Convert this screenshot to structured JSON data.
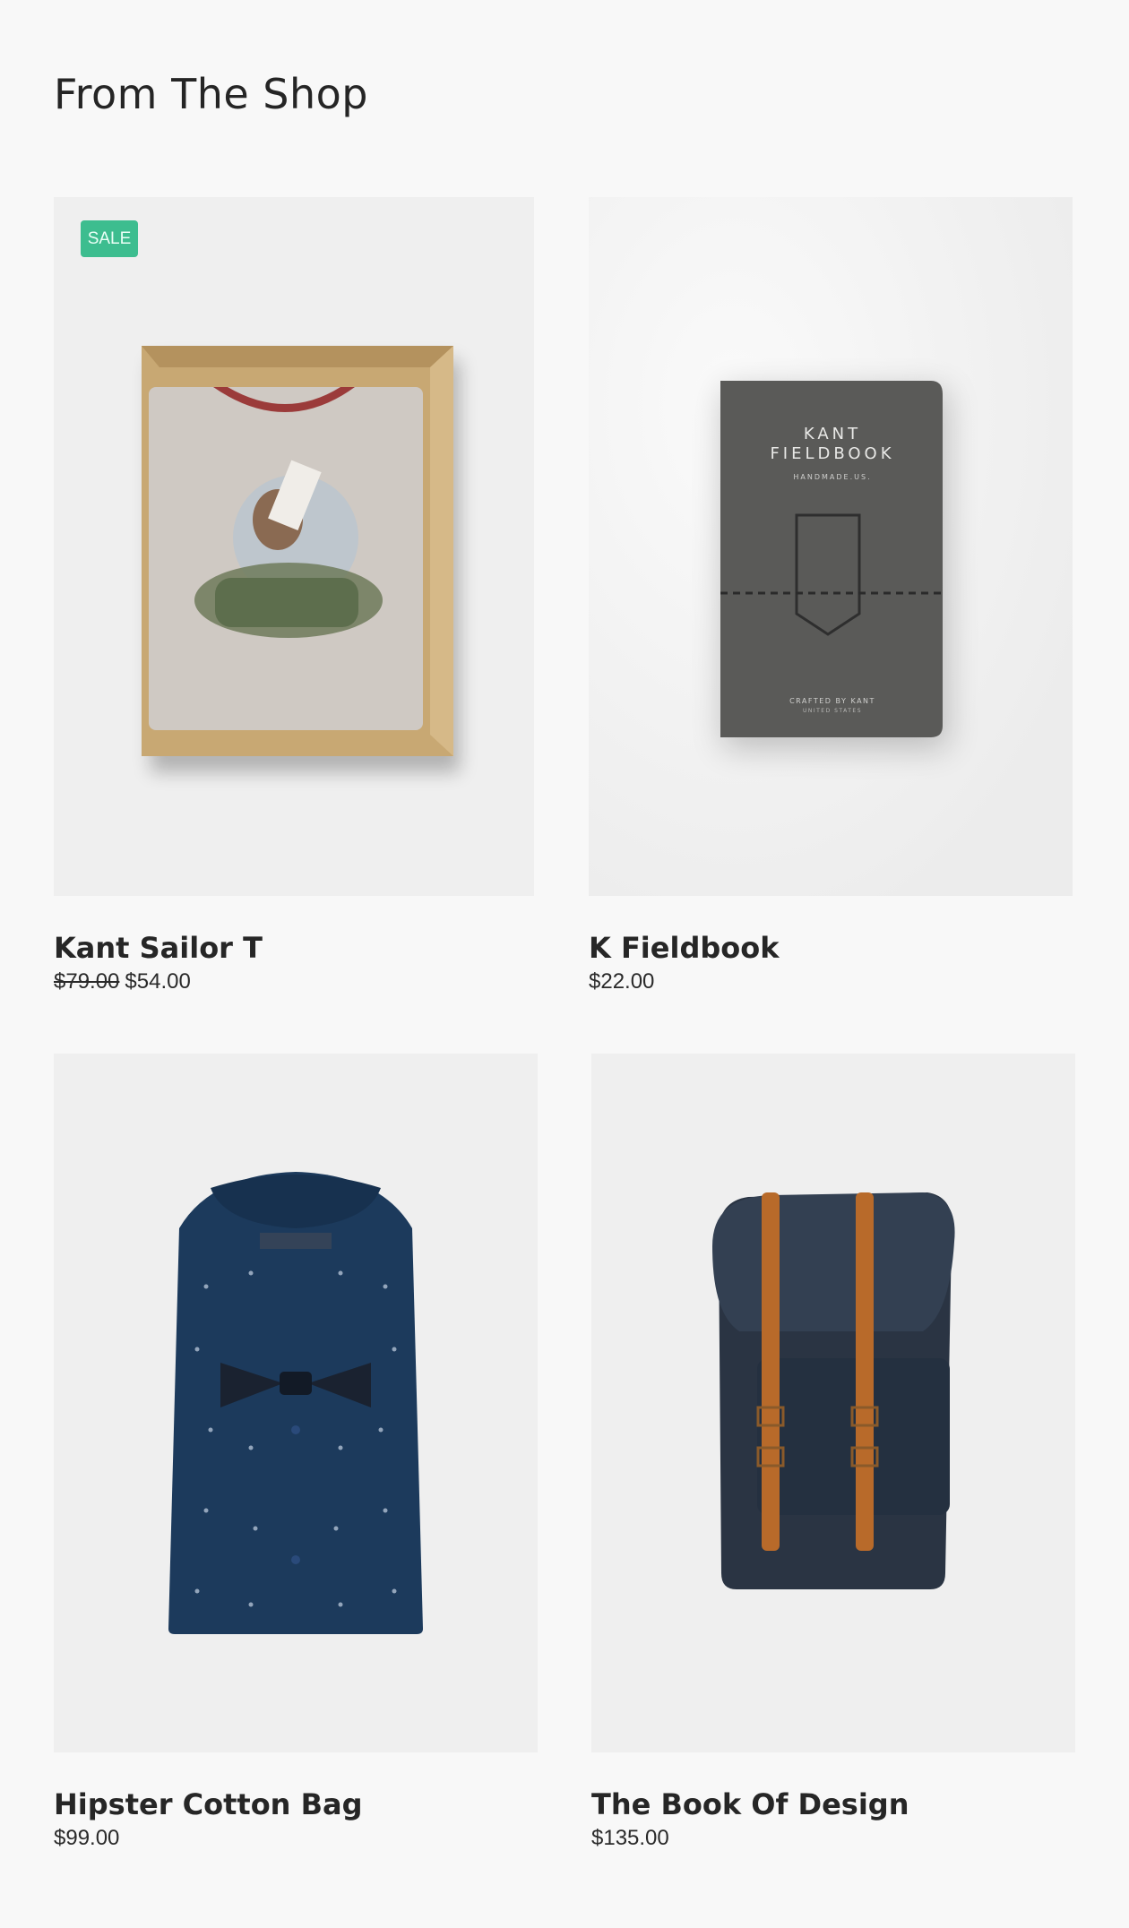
{
  "section": {
    "title": "From The Shop"
  },
  "products": [
    {
      "name": "Kant Sailor T",
      "old_price": "$79.00",
      "price": "$54.00",
      "badge": "SALE"
    },
    {
      "name": "K Fieldbook",
      "price": "$22.00",
      "cover": {
        "brand_line1": "KANT",
        "brand_line2": "FIELDBOOK",
        "tagline": "HANDMADE.US.",
        "crafted": "CRAFTED BY KANT",
        "origin": "UNITED STATES"
      }
    },
    {
      "name": "Hipster Cotton Bag",
      "price": "$99.00"
    },
    {
      "name": "The Book Of Design",
      "price": "$135.00"
    }
  ],
  "colors": {
    "sale_badge": "#3dbd8f",
    "tile_bg": "#efefef",
    "page_bg": "#f8f8f8"
  }
}
